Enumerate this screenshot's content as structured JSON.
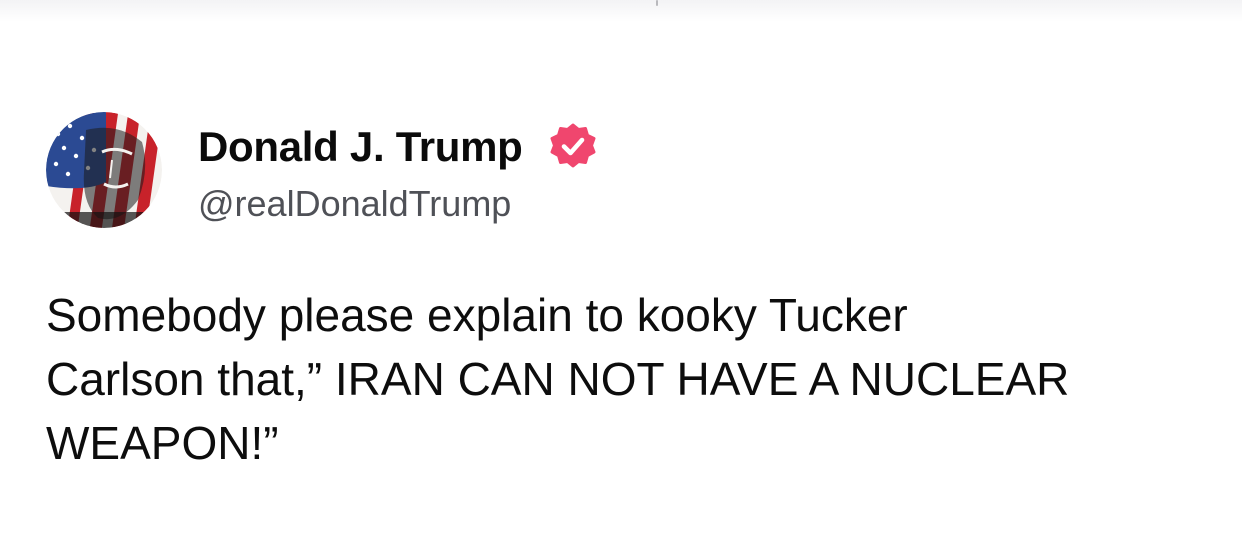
{
  "post": {
    "author": {
      "display_name": "Donald J. Trump",
      "handle": "@realDonaldTrump",
      "verified": true,
      "badge_color": "#f0466e",
      "avatar_icon": "profile-avatar"
    },
    "text_lines": [
      "Somebody please explain to kooky Tucker",
      "Carlson that,” IRAN CAN NOT HAVE A NUCLEAR",
      "WEAPON!”"
    ]
  },
  "colors": {
    "background": "#ffffff",
    "text": "#0d0d0d",
    "handle": "#4f5157",
    "verified_badge": "#f0466e"
  }
}
